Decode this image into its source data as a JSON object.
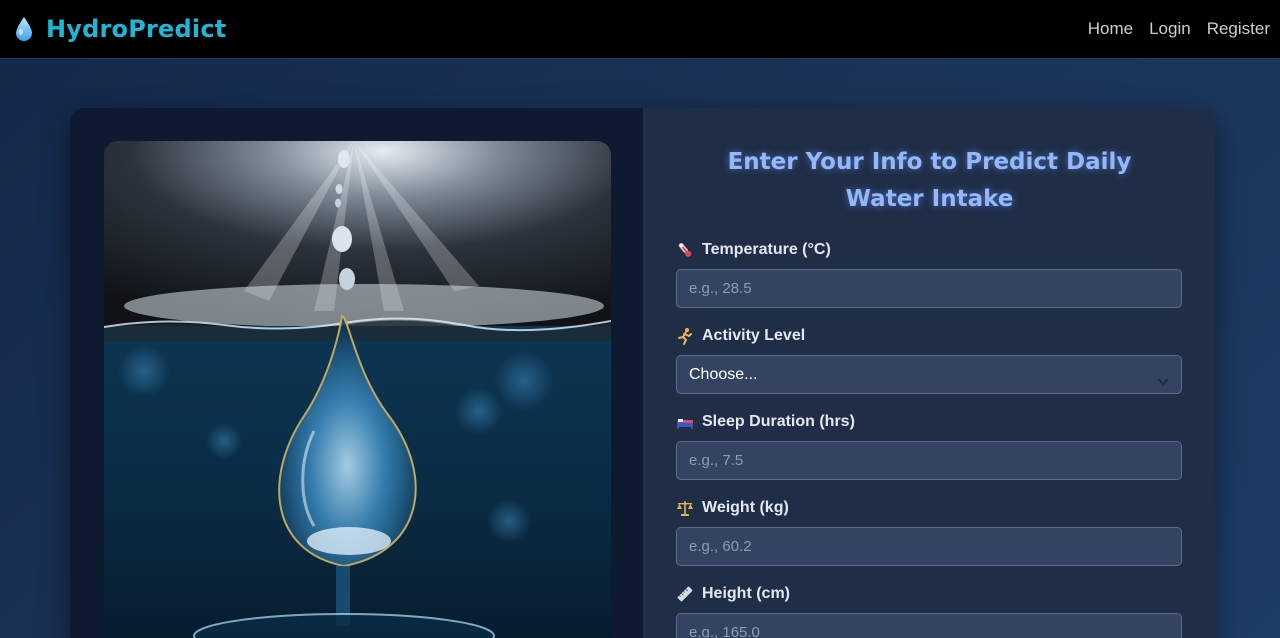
{
  "brand": {
    "name": "HydroPredict",
    "icon": "water-drop-icon",
    "color": "#1fb6d6"
  },
  "nav": {
    "home": "Home",
    "login": "Login",
    "register": "Register"
  },
  "form": {
    "title": "Enter Your Info to Predict Daily Water Intake",
    "fields": {
      "temperature": {
        "label": "Temperature (°C)",
        "placeholder": "e.g., 28.5",
        "icon": "thermometer-icon"
      },
      "activity": {
        "label": "Activity Level",
        "value": "Choose...",
        "icon": "running-person-icon"
      },
      "sleep": {
        "label": "Sleep Duration (hrs)",
        "placeholder": "e.g., 7.5",
        "icon": "bed-icon"
      },
      "weight": {
        "label": "Weight (kg)",
        "placeholder": "e.g., 60.2",
        "icon": "scale-icon"
      },
      "height": {
        "label": "Height (cm)",
        "placeholder": "e.g., 165.0",
        "icon": "ruler-icon"
      }
    }
  },
  "colors": {
    "accent": "#93b8ff",
    "input_bg": "#334462",
    "panel_bg": "#1f2d47"
  }
}
